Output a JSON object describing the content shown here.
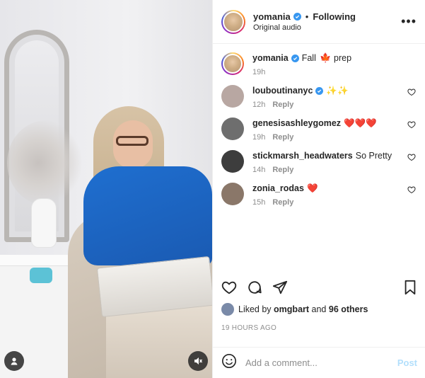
{
  "header": {
    "username": "yomania",
    "separator": "•",
    "follow_status": "Following",
    "audio": "Original audio",
    "more_icon": "more-horizontal-icon"
  },
  "caption": {
    "username": "yomania",
    "text_before": "Fall",
    "emoji": "🍁",
    "text_after": "prep",
    "time": "19h"
  },
  "comments": [
    {
      "username": "louboutinanyc",
      "verified": true,
      "text": "✨✨",
      "time": "12h",
      "reply": "Reply",
      "avatar_color": "#b8a7a2"
    },
    {
      "username": "genesisashleygomez",
      "verified": false,
      "text": "❤️❤️❤️",
      "time": "19h",
      "reply": "Reply",
      "avatar_color": "#6e6e6e"
    },
    {
      "username": "stickmarsh_headwaters",
      "verified": false,
      "text": "So Pretty",
      "time": "14h",
      "reply": "Reply",
      "avatar_color": "#3d3d3d"
    },
    {
      "username": "zonia_rodas",
      "verified": false,
      "text": "❤️",
      "time": "15h",
      "reply": "Reply",
      "avatar_color": "#8a7769"
    }
  ],
  "actions": {
    "like_icon": "heart-icon",
    "comment_icon": "comment-icon",
    "share_icon": "share-icon",
    "save_icon": "bookmark-icon"
  },
  "likes": {
    "prefix": "Liked by",
    "user": "omgbart",
    "connector": "and",
    "others": "96 others"
  },
  "timestamp": "19 HOURS AGO",
  "add_comment": {
    "emoji_icon": "smiley-icon",
    "placeholder": "Add a comment...",
    "post_label": "Post"
  },
  "media": {
    "user_icon": "user-tag-icon",
    "mute_icon": "muted-speaker-icon"
  },
  "colors": {
    "verified": "#3897f0",
    "heart": "#e0245e",
    "text": "#262626",
    "muted": "#8e8e8e"
  }
}
